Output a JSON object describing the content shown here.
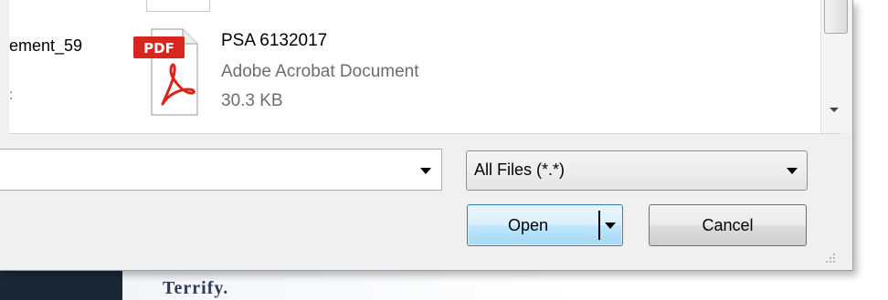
{
  "files": {
    "left_item": {
      "name": "ement_59",
      "sub": ":"
    },
    "selected_item": {
      "icon_badge": "PDF",
      "name": "PSA 6132017",
      "type": "Adobe Acrobat Document",
      "size": "30.3 KB"
    }
  },
  "filename_field": {
    "value": ""
  },
  "file_type_filter": {
    "selected": "All Files (*.*)"
  },
  "buttons": {
    "open": "Open",
    "cancel": "Cancel"
  },
  "background": {
    "text": "Terrify."
  },
  "colors": {
    "pdf_red": "#d9261c",
    "open_border": "#3c7fb1"
  }
}
